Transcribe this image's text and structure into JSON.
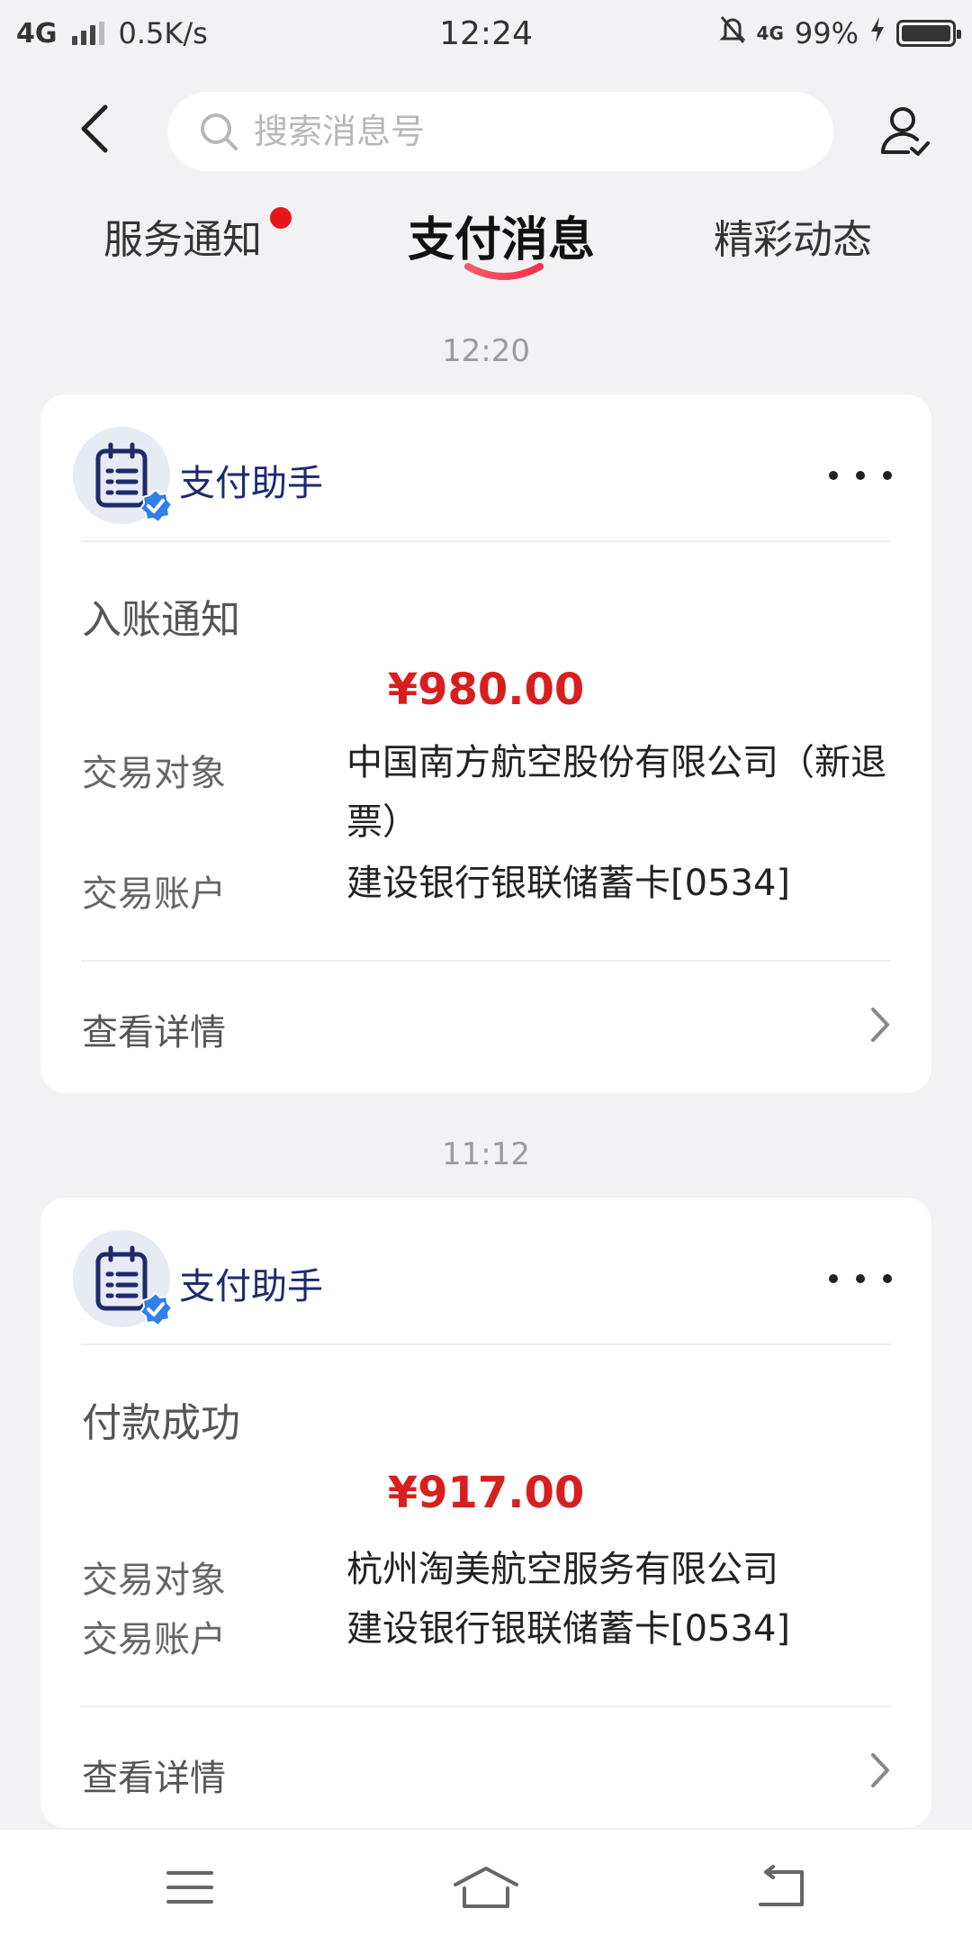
{
  "status_bar": {
    "network": "4G",
    "speed": "0.5K/s",
    "time": "12:24",
    "network_right": "4G",
    "battery": "99%"
  },
  "search": {
    "placeholder": "搜索消息号"
  },
  "tabs": [
    {
      "label": "服务通知",
      "has_dot": true
    },
    {
      "label": "支付消息",
      "active": true
    },
    {
      "label": "精彩动态"
    }
  ],
  "messages": [
    {
      "time": "12:20",
      "sender": "支付助手",
      "title": "入账通知",
      "amount": "¥980.00",
      "rows": [
        {
          "label": "交易对象",
          "value": "中国南方航空股份有限公司（新退票）"
        },
        {
          "label": "交易账户",
          "value": "建设银行银联储蓄卡[0534]"
        }
      ],
      "details": "查看详情"
    },
    {
      "time": "11:12",
      "sender": "支付助手",
      "title": "付款成功",
      "amount": "¥917.00",
      "rows": [
        {
          "label": "交易对象",
          "value": "杭州淘美航空服务有限公司"
        },
        {
          "label": "交易账户",
          "value": "建设银行银联储蓄卡[0534]"
        }
      ],
      "details": "查看详情"
    }
  ],
  "colors": {
    "amount": "#d81e1e",
    "sender": "#1d2a6b",
    "dot": "#e5161c",
    "tab_underline": "#f0465a",
    "verified": "#2f80ed"
  },
  "icons": {
    "back": "chevron-left-icon",
    "search": "search-icon",
    "contact": "user-check-icon",
    "avatar": "clipboard-list-icon",
    "verified": "verified-badge-icon",
    "more": "more-horizontal-icon",
    "chevron": "chevron-right-icon",
    "nav": [
      "menu-icon",
      "home-icon",
      "back-return-icon"
    ]
  }
}
